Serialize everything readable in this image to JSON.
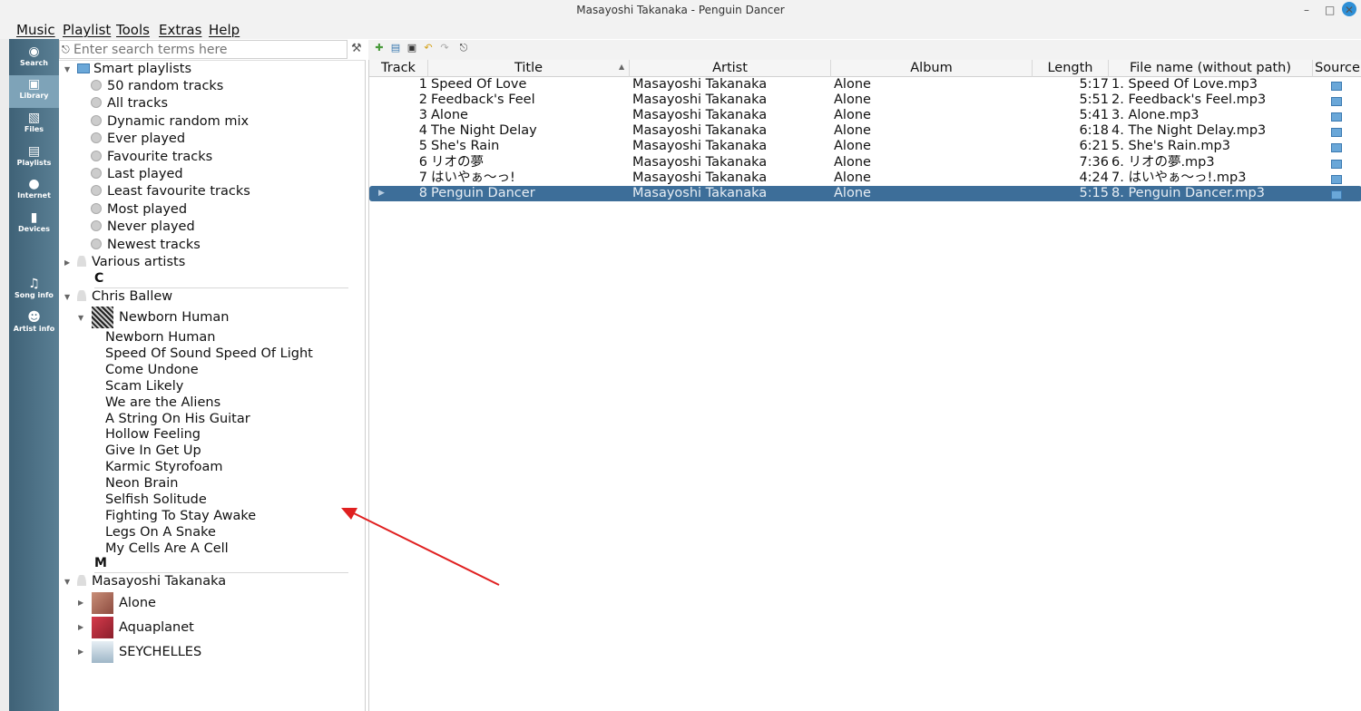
{
  "window": {
    "title": "Masayoshi Takanaka - Penguin Dancer"
  },
  "menu": [
    "Music",
    "Playlist",
    "Tools",
    "Extras",
    "Help"
  ],
  "sidebar": {
    "tabs": [
      {
        "label": "Search",
        "icon": "search-icon"
      },
      {
        "label": "Library",
        "icon": "library-icon",
        "active": true
      },
      {
        "label": "Files",
        "icon": "files-icon"
      },
      {
        "label": "Playlists",
        "icon": "playlists-icon"
      },
      {
        "label": "Internet",
        "icon": "internet-icon"
      },
      {
        "label": "Devices",
        "icon": "devices-icon"
      },
      {
        "label": "Song info",
        "icon": "song-info-icon"
      },
      {
        "label": "Artist info",
        "icon": "artist-info-icon"
      }
    ]
  },
  "search": {
    "placeholder": "Enter search terms here"
  },
  "library": {
    "smart_playlists_label": "Smart playlists",
    "smart_playlists": [
      "50 random tracks",
      "All tracks",
      "Dynamic random mix",
      "Ever played",
      "Favourite tracks",
      "Last played",
      "Least favourite tracks",
      "Most played",
      "Never played",
      "Newest tracks"
    ],
    "various_artists": "Various artists",
    "letter_c": "C",
    "artist_chris": "Chris Ballew",
    "album_newborn": "Newborn Human",
    "newborn_tracks": [
      "Newborn Human",
      "Speed Of Sound Speed Of Light",
      "Come Undone",
      "Scam Likely",
      "We are the Aliens",
      "A String On His Guitar",
      "Hollow Feeling",
      "Give In Get Up",
      "Karmic Styrofoam",
      "Neon Brain",
      "Selfish Solitude",
      "Fighting To Stay Awake",
      "Legs On A Snake",
      "My Cells Are A Cell"
    ],
    "letter_m": "M",
    "artist_masayoshi": "Masayoshi Takanaka",
    "masayoshi_albums": [
      "Alone",
      "Aquaplanet",
      "SEYCHELLES"
    ]
  },
  "playlist": {
    "columns": [
      "Track",
      "Title",
      "Artist",
      "Album",
      "Length",
      "File name (without path)",
      "Source"
    ],
    "rows": [
      {
        "track": "1",
        "title": "Speed Of Love",
        "artist": "Masayoshi Takanaka",
        "album": "Alone",
        "length": "5:17",
        "file": "1. Speed Of Love.mp3"
      },
      {
        "track": "2",
        "title": "Feedback's Feel",
        "artist": "Masayoshi Takanaka",
        "album": "Alone",
        "length": "5:51",
        "file": "2. Feedback's Feel.mp3"
      },
      {
        "track": "3",
        "title": "Alone",
        "artist": "Masayoshi Takanaka",
        "album": "Alone",
        "length": "5:41",
        "file": "3. Alone.mp3"
      },
      {
        "track": "4",
        "title": "The Night Delay",
        "artist": "Masayoshi Takanaka",
        "album": "Alone",
        "length": "6:18",
        "file": "4. The Night Delay.mp3"
      },
      {
        "track": "5",
        "title": "She's Rain",
        "artist": "Masayoshi Takanaka",
        "album": "Alone",
        "length": "6:21",
        "file": "5. She's Rain.mp3"
      },
      {
        "track": "6",
        "title": "リオの夢",
        "artist": "Masayoshi Takanaka",
        "album": "Alone",
        "length": "7:36",
        "file": "6. リオの夢.mp3"
      },
      {
        "track": "7",
        "title": "はいやぁ～っ!",
        "artist": "Masayoshi Takanaka",
        "album": "Alone",
        "length": "4:24",
        "file": "7. はいやぁ～っ!.mp3"
      },
      {
        "track": "8",
        "title": "Penguin Dancer",
        "artist": "Masayoshi Takanaka",
        "album": "Alone",
        "length": "5:15",
        "file": "8. Penguin Dancer.mp3",
        "current": true
      }
    ]
  },
  "colors": {
    "sidebar": "#4d7287",
    "selection": "#3d6e99",
    "annotation_arrow": "#e02020"
  }
}
